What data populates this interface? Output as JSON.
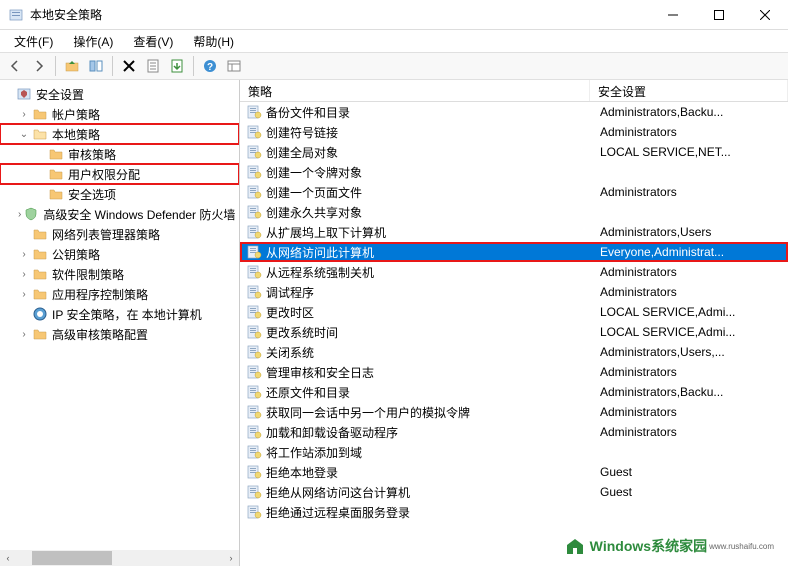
{
  "window": {
    "title": "本地安全策略"
  },
  "menu": {
    "file": "文件(F)",
    "action": "操作(A)",
    "view": "查看(V)",
    "help": "帮助(H)"
  },
  "tree": {
    "root": "安全设置",
    "account": "帐户策略",
    "local": "本地策略",
    "audit": "审核策略",
    "rights": "用户权限分配",
    "options": "安全选项",
    "defender": "高级安全 Windows Defender 防火墙",
    "netlist": "网络列表管理器策略",
    "pubkey": "公钥策略",
    "softlimit": "软件限制策略",
    "appctrl": "应用程序控制策略",
    "ipsec": "IP 安全策略，在 本地计算机",
    "advaudit": "高级审核策略配置"
  },
  "list": {
    "header_policy": "策略",
    "header_setting": "安全设置",
    "rows": [
      {
        "policy": "备份文件和目录",
        "setting": "Administrators,Backu..."
      },
      {
        "policy": "创建符号链接",
        "setting": "Administrators"
      },
      {
        "policy": "创建全局对象",
        "setting": "LOCAL SERVICE,NET..."
      },
      {
        "policy": "创建一个令牌对象",
        "setting": ""
      },
      {
        "policy": "创建一个页面文件",
        "setting": "Administrators"
      },
      {
        "policy": "创建永久共享对象",
        "setting": ""
      },
      {
        "policy": "从扩展坞上取下计算机",
        "setting": "Administrators,Users"
      },
      {
        "policy": "从网络访问此计算机",
        "setting": "Everyone,Administrat...",
        "selected": true
      },
      {
        "policy": "从远程系统强制关机",
        "setting": "Administrators"
      },
      {
        "policy": "调试程序",
        "setting": "Administrators"
      },
      {
        "policy": "更改时区",
        "setting": "LOCAL SERVICE,Admi..."
      },
      {
        "policy": "更改系统时间",
        "setting": "LOCAL SERVICE,Admi..."
      },
      {
        "policy": "关闭系统",
        "setting": "Administrators,Users,..."
      },
      {
        "policy": "管理审核和安全日志",
        "setting": "Administrators"
      },
      {
        "policy": "还原文件和目录",
        "setting": "Administrators,Backu..."
      },
      {
        "policy": "获取同一会话中另一个用户的模拟令牌",
        "setting": "Administrators"
      },
      {
        "policy": "加载和卸载设备驱动程序",
        "setting": "Administrators"
      },
      {
        "policy": "将工作站添加到域",
        "setting": ""
      },
      {
        "policy": "拒绝本地登录",
        "setting": "Guest"
      },
      {
        "policy": "拒绝从网络访问这台计算机",
        "setting": "Guest"
      },
      {
        "policy": "拒绝通过远程桌面服务登录",
        "setting": ""
      }
    ]
  },
  "watermark": {
    "text": "indows系统家园",
    "sub": "www.rushaifu.com"
  }
}
